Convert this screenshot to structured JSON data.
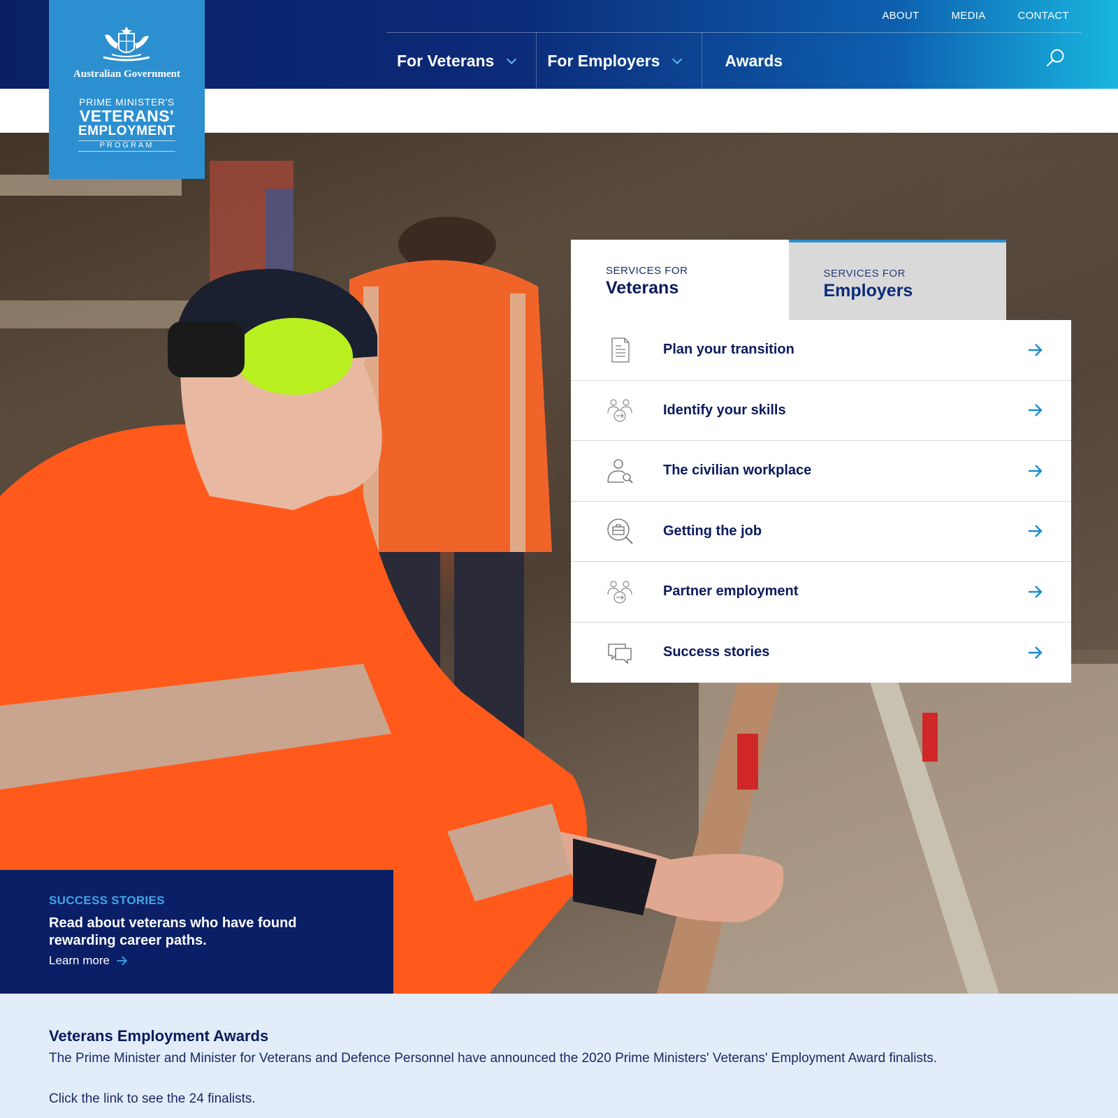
{
  "logo": {
    "gov": "Australian Government",
    "line1": "PRIME MINISTER'S",
    "line2": "VETERANS'",
    "line3": "EMPLOYMENT",
    "line4": "PROGRAM",
    "crest_icon": "coat-of-arms-icon"
  },
  "utility_nav": [
    "ABOUT",
    "MEDIA",
    "CONTACT"
  ],
  "main_nav": [
    {
      "label": "For Veterans",
      "has_dropdown": true
    },
    {
      "label": "For Employers",
      "has_dropdown": true
    },
    {
      "label": "Awards",
      "has_dropdown": false
    }
  ],
  "search_icon": "search-icon",
  "services": {
    "tabs": [
      {
        "small": "SERVICES FOR",
        "big": "Veterans",
        "active": true
      },
      {
        "small": "SERVICES FOR",
        "big": "Employers",
        "active": false
      }
    ],
    "items": [
      {
        "label": "Plan your transition",
        "icon": "document-icon"
      },
      {
        "label": "Identify your skills",
        "icon": "people-exchange-icon"
      },
      {
        "label": "The civilian workplace",
        "icon": "person-search-icon"
      },
      {
        "label": "Getting the job",
        "icon": "briefcase-search-icon"
      },
      {
        "label": "Partner employment",
        "icon": "people-exchange-icon"
      },
      {
        "label": "Success stories",
        "icon": "chat-bubbles-icon"
      }
    ]
  },
  "story": {
    "kicker": "SUCCESS STORIES",
    "text": "Read about veterans who have found rewarding career paths.",
    "link": "Learn more"
  },
  "awards": {
    "title": "Veterans Employment Awards",
    "p1": "The Prime Minister and Minister for Veterans and Defence Personnel have announced the 2020 Prime Ministers' Veterans' Employment Award finalists.",
    "p2": "Click the link to see the 24 finalists."
  },
  "colors": {
    "navy": "#0a1f66",
    "logo_blue": "#2b8fd0",
    "accent": "#3fa6e8",
    "awards_bg": "#e3edf9"
  }
}
